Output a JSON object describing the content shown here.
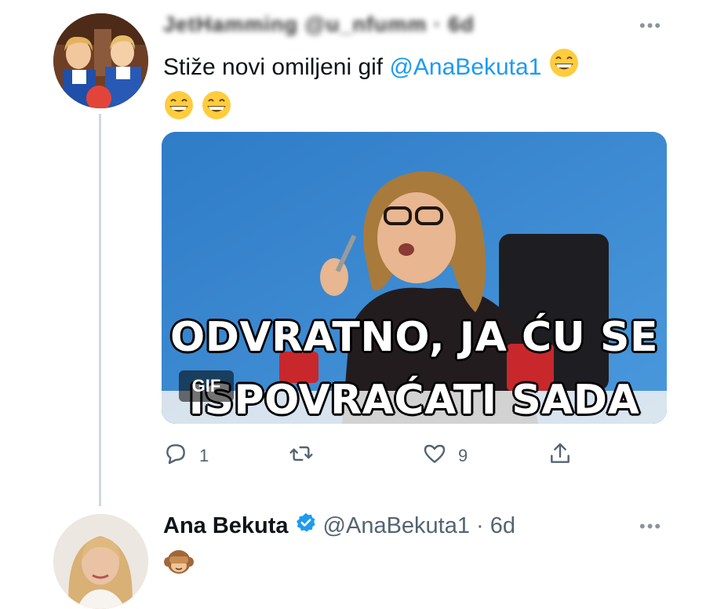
{
  "tweet1": {
    "author_blurred": "JetHamming @u_nfumm · 6d",
    "text_before": "Stiže novi omiljeni gif ",
    "mention": "@AnaBekuta1",
    "emoji_names": [
      "grinning-face-icon",
      "grinning-face-icon",
      "grinning-face-icon"
    ],
    "media": {
      "caption_line1": "ODVRATNO, JA ĆU SE",
      "caption_line2": "ISPOVRAĆATI SADA",
      "badge": "GIF"
    },
    "actions": {
      "reply_count": "1",
      "retweet_count": "",
      "like_count": "9"
    }
  },
  "tweet2": {
    "author_name": "Ana Bekuta",
    "handle_time": "@AnaBekuta1 · 6d",
    "emoji_name": "see-no-evil-monkey-icon"
  },
  "colors": {
    "accent": "#1d9bf0",
    "muted": "#536471",
    "thread_line": "#cfd9de"
  }
}
